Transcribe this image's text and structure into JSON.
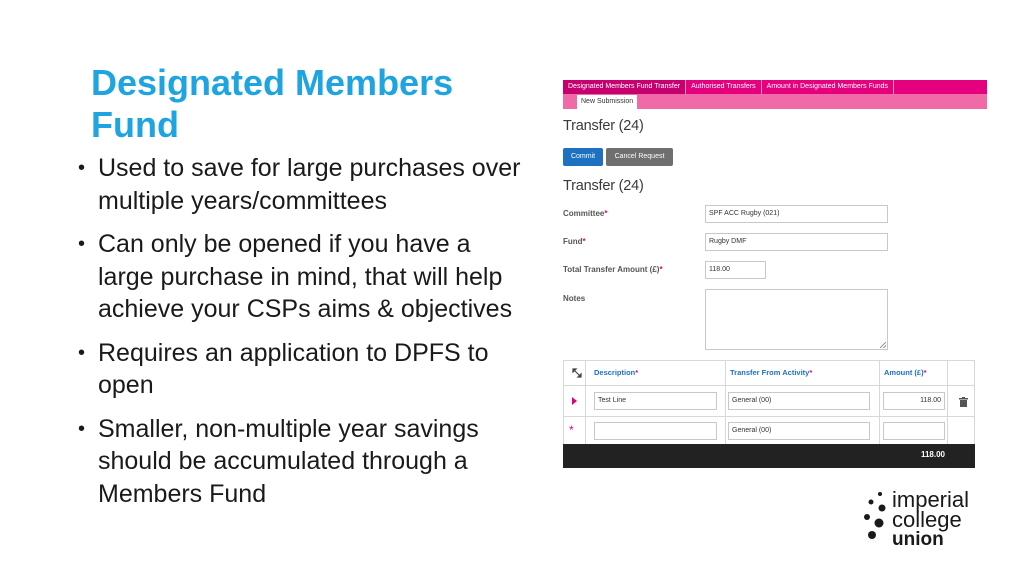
{
  "slide": {
    "title_line1": "Designated Members",
    "title_line2": "Fund",
    "bullets": [
      {
        "line1": "Used to save for large purchases over",
        "line2": "multiple years/committees"
      },
      {
        "line1": "Can only be opened if you have a",
        "line2": "large purchase in mind, that will help",
        "line3": "achieve your CSPs aims & objectives"
      },
      {
        "line1": "Requires an application to DPFS to",
        "line2": "open"
      },
      {
        "line1": "Smaller, non-multiple year savings",
        "line2": "should be accumulated through a",
        "line3": "Members Fund"
      }
    ],
    "bullet_glyph": "•"
  },
  "app": {
    "tabs": [
      "Designated Members Fund Transfer",
      "Authorised Transfers",
      "Amount in Designated Members Funds"
    ],
    "subtab": "New Submission",
    "heading1": "Transfer (24)",
    "heading2": "Transfer (24)",
    "buttons": {
      "commit": "Commit",
      "cancel": "Cancel Request"
    },
    "form": {
      "committee_label": "Committee",
      "committee_value": "SPF ACC Rugby (021)",
      "fund_label": "Fund",
      "fund_value": "Rugby DMF",
      "total_label": "Total Transfer Amount (£)",
      "total_value": "118.00",
      "notes_label": "Notes",
      "required_marker": "*"
    },
    "grid": {
      "headers": {
        "description": "Description",
        "activity": "Transfer From Activity",
        "amount": "Amount (£)"
      },
      "rows": [
        {
          "description": "Test Line",
          "activity": "General (00)",
          "amount": "118.00"
        },
        {
          "description": "",
          "activity": "General (00)",
          "amount": ""
        }
      ],
      "new_row_marker": "*",
      "total": "118.00"
    }
  },
  "logo": {
    "line1": "imperial",
    "line2": "college",
    "line3": "union"
  },
  "colors": {
    "title": "#1ea4e0",
    "tabbar": "#e5007e",
    "subbar": "#f06aa7",
    "commit": "#1e70c1",
    "cancel": "#6f6f6f"
  }
}
